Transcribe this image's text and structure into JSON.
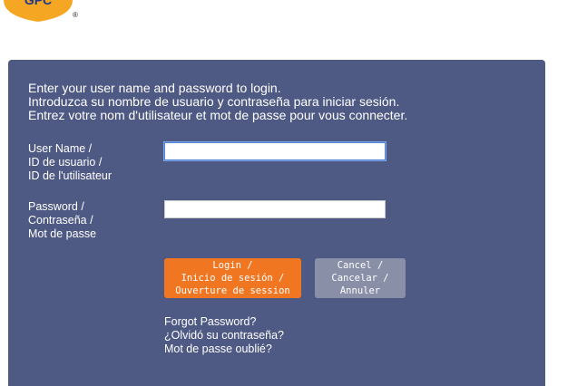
{
  "brand": {
    "logo_text": "GPC",
    "registered_mark": "®",
    "logo_color": "#f5a623"
  },
  "intro": {
    "line_en": "Enter your user name and password to login.",
    "line_es": "Introduzca su nombre de usuario y contraseña para iniciar sesión.",
    "line_fr": "Entrez votre nom d'utilisateur et mot de passe pour vous connecter."
  },
  "username": {
    "label_en": "User Name /",
    "label_es": "ID de usuario /",
    "label_fr": "ID de l'utilisateur",
    "value": "",
    "focused": true
  },
  "password": {
    "label_en": "Password /",
    "label_es": "Contraseña /",
    "label_fr": "Mot de passe",
    "value": ""
  },
  "login_button": {
    "line_en": "Login /",
    "line_es": "Inicio de sesión /",
    "line_fr": "Ouverture de session"
  },
  "cancel_button": {
    "line_en": "Cancel /",
    "line_es": "Cancelar /",
    "line_fr": "Annuler"
  },
  "forgot": {
    "line_en": "Forgot Password?",
    "line_es": "¿Olvidó su contraseña?",
    "line_fr": "Mot de passe oublié?"
  },
  "colors": {
    "panel": "#4f5a84",
    "login_button": "#f07622",
    "cancel_button": "#8a8fa8",
    "text": "#ffffff"
  }
}
